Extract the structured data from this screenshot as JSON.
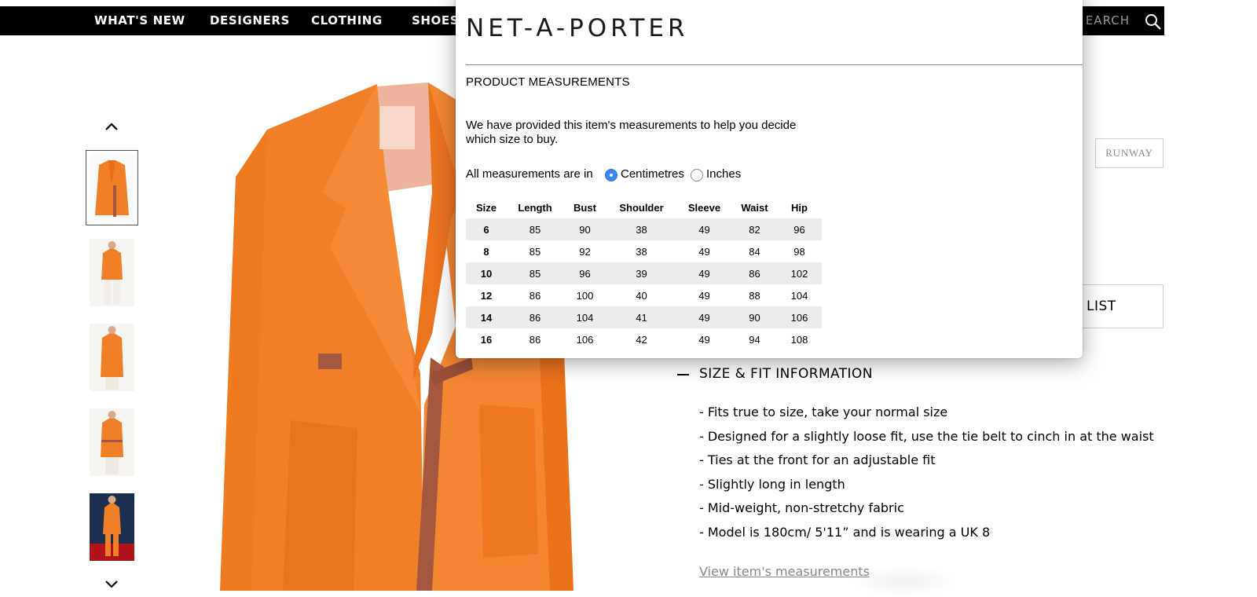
{
  "nav": {
    "items": [
      "WHAT'S NEW",
      "DESIGNERS",
      "CLOTHING",
      "SHOES"
    ],
    "search_label": "EARCH"
  },
  "product": {
    "runway_label": "RUNWAY",
    "wishlist_label": "LIST"
  },
  "size_fit": {
    "heading": "SIZE & FIT INFORMATION",
    "points": [
      "- Fits true to size, take your normal size",
      "- Designed for a slightly loose fit, use the tie belt to cinch in at the waist",
      "- Ties at the front for an adjustable fit",
      "- Slightly long in length",
      "- Mid-weight, non-stretchy fabric",
      "- Model is 180cm/ 5'11” and is wearing a UK 8"
    ],
    "measurements_link": "View item's measurements"
  },
  "modal": {
    "brand": "NET-A-PORTER",
    "title": "PRODUCT MEASUREMENTS",
    "description": "We have provided this item's measurements to help you decide which size to buy.",
    "unit_prompt": "All measurements are in",
    "units": [
      {
        "label": "Centimetres",
        "selected": true
      },
      {
        "label": "Inches",
        "selected": false
      }
    ],
    "table": {
      "headers": [
        "Size",
        "Length",
        "Bust",
        "Shoulder",
        "Sleeve",
        "Waist",
        "Hip"
      ],
      "rows": [
        [
          "6",
          "85",
          "90",
          "38",
          "49",
          "82",
          "96"
        ],
        [
          "8",
          "85",
          "92",
          "38",
          "49",
          "84",
          "98"
        ],
        [
          "10",
          "85",
          "96",
          "39",
          "49",
          "86",
          "102"
        ],
        [
          "12",
          "86",
          "100",
          "40",
          "49",
          "88",
          "104"
        ],
        [
          "14",
          "86",
          "104",
          "41",
          "49",
          "90",
          "106"
        ],
        [
          "16",
          "86",
          "106",
          "42",
          "49",
          "94",
          "108"
        ]
      ]
    }
  },
  "thumbnails": {
    "count": 5,
    "selected_index": 0
  },
  "colors": {
    "nav_bg": "#000000",
    "jacket": "#f07f2a",
    "belt": "#a5573d",
    "radio_selected": "#3b86f7",
    "table_shade": "#ececec"
  },
  "icons": [
    "search-icon",
    "chevron-up-icon",
    "chevron-down-icon",
    "minus-icon"
  ]
}
